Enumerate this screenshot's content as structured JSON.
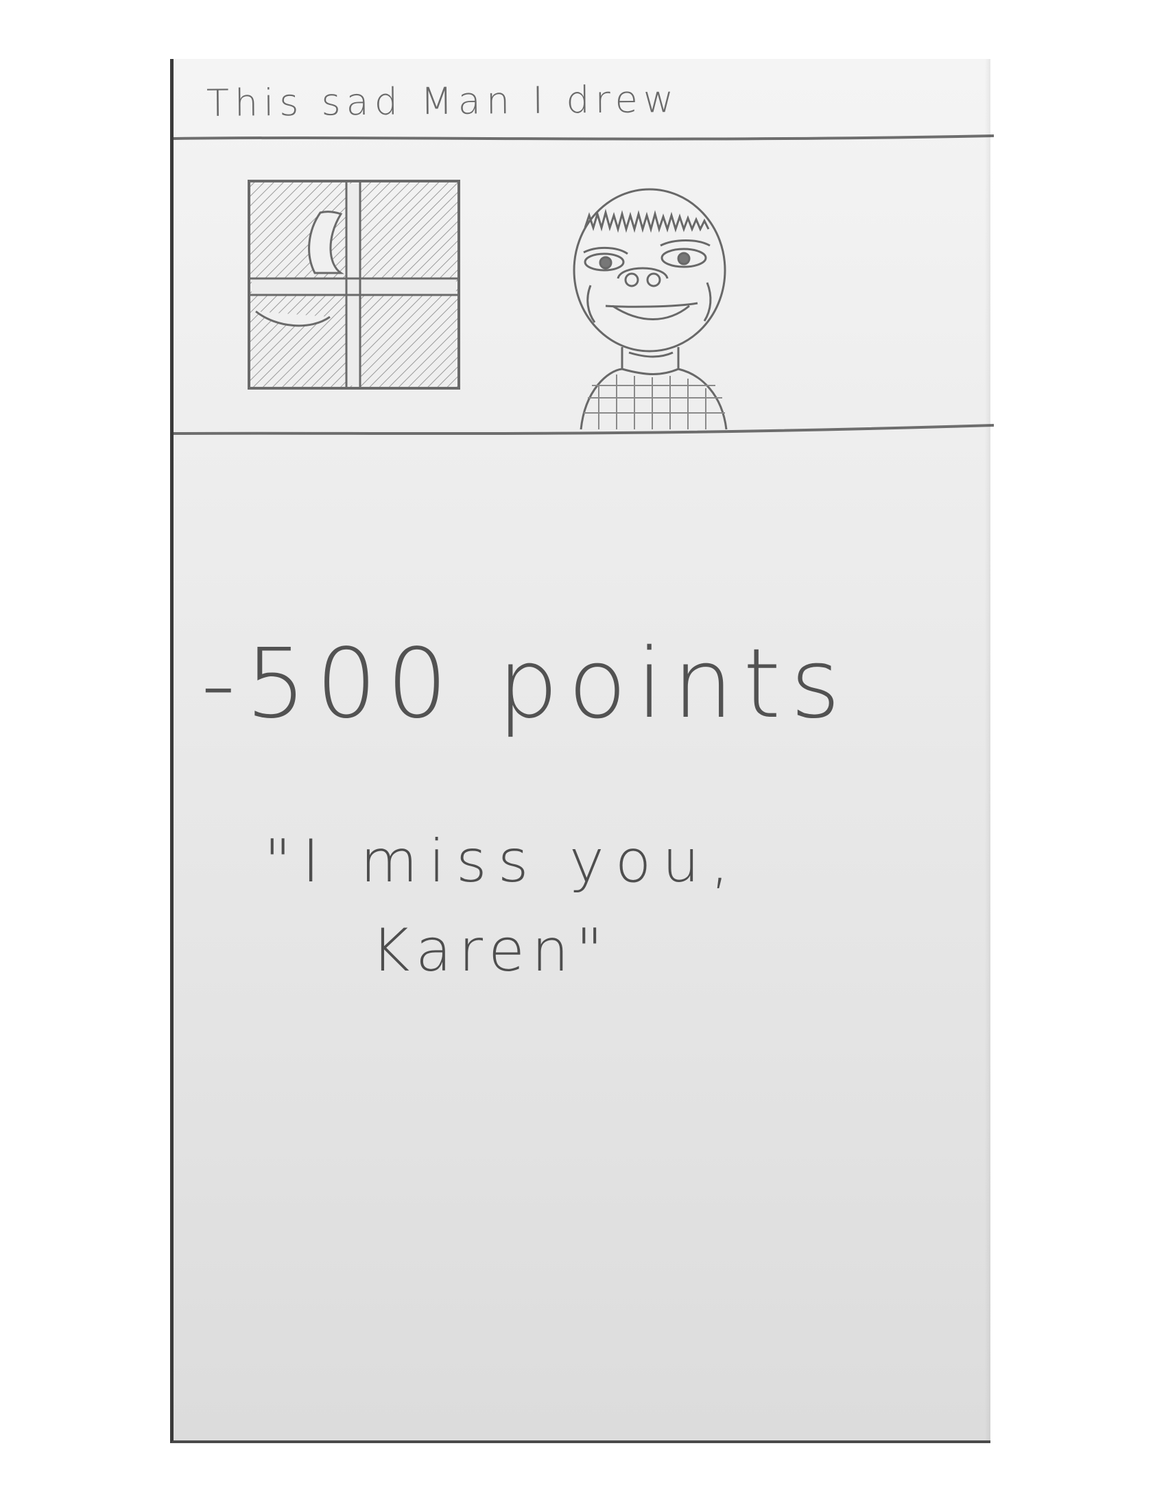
{
  "caption": "This sad Man I drew",
  "score": "-500 points",
  "quote": {
    "line1": "\"I miss you,",
    "line2": "Karen\""
  },
  "colors": {
    "paper": "#ececec",
    "pencil": "#5a5a5a",
    "shading": "#9a9a9a"
  },
  "drawing": {
    "subjects": [
      "window-with-moon",
      "sad-man-portrait"
    ],
    "icons": [
      "moon-icon",
      "window-icon",
      "man-icon"
    ]
  }
}
